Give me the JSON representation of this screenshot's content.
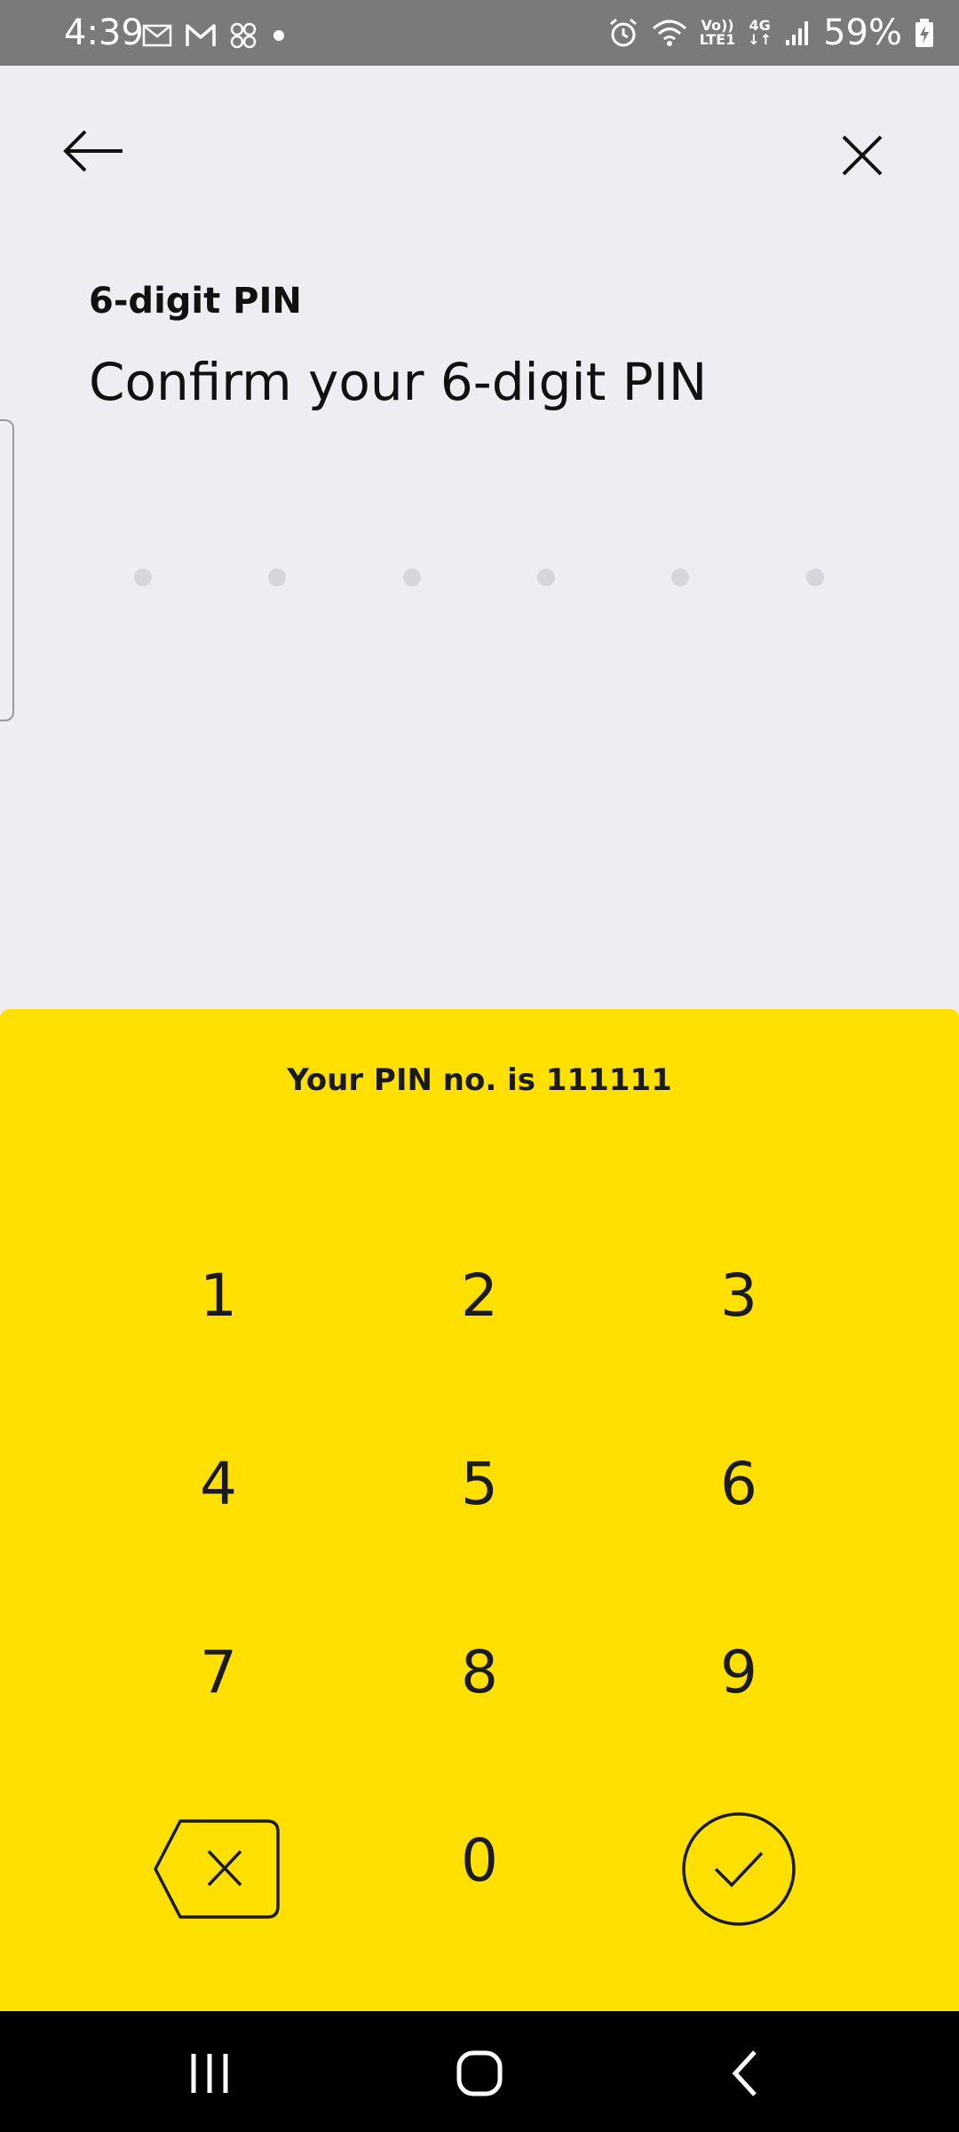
{
  "status_bar": {
    "time": "4:39",
    "battery": "59%",
    "network_top": "Vo))",
    "network_bottom": "LTE1",
    "network_gen": "4G"
  },
  "header": {
    "back_icon": "arrow-left-icon",
    "close_icon": "close-icon"
  },
  "content": {
    "subtitle": "6-digit PIN",
    "title": "Confirm your 6-digit PIN",
    "pin_dot_count": 6
  },
  "keypad": {
    "hint": "Your PIN no. is 111111",
    "keys": [
      "1",
      "2",
      "3",
      "4",
      "5",
      "6",
      "7",
      "8",
      "9",
      "0"
    ],
    "backspace_icon": "backspace-icon",
    "confirm_icon": "check-circle-icon",
    "accent_color": "#ffe000"
  },
  "system_nav": {
    "recents_icon": "recents-icon",
    "home_icon": "home-icon",
    "back_icon": "back-chevron-icon"
  }
}
